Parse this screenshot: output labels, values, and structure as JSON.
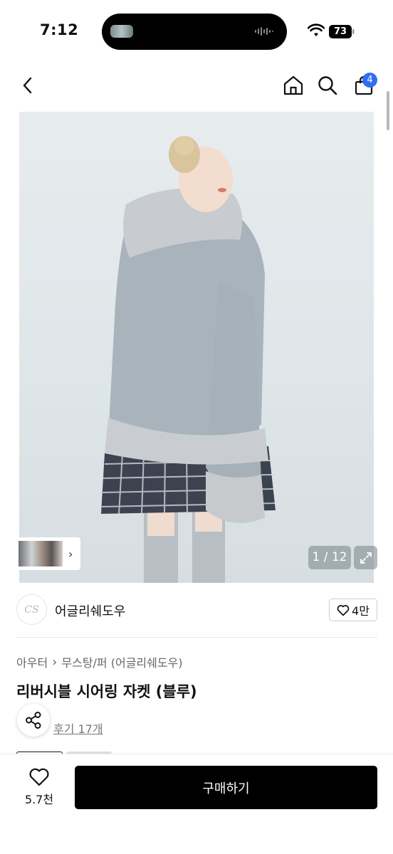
{
  "status_bar": {
    "time": "7:12",
    "battery": "73"
  },
  "nav": {
    "cart_count": "4"
  },
  "product": {
    "image_counter": "1 / 12",
    "brand_logo_text": "CS",
    "brand_name": "어글리쉐도우",
    "like_count": "4만",
    "breadcrumb": [
      "아우터",
      "무스탕/퍼 (어글리쉐도우)"
    ],
    "title": "리버시블 시어링 자켓 (블루)",
    "review_link": "후기 17개"
  },
  "bottom_bar": {
    "wish_count": "5.7천",
    "buy_label": "구매하기"
  },
  "colors": {
    "accent": "#2f6ef2",
    "primary_button": "#000000"
  }
}
